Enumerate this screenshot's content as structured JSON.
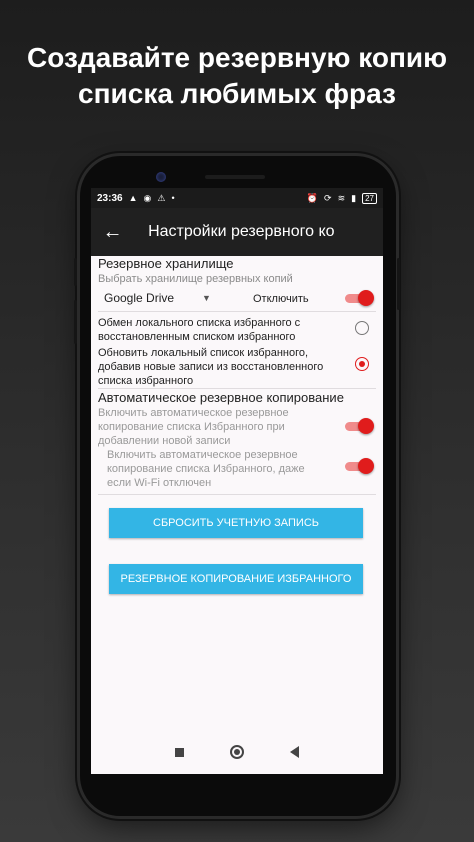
{
  "headline": {
    "line1": "Создавайте резервную копию",
    "line2": "списка любимых фраз"
  },
  "statusbar": {
    "time": "23:36",
    "battery": "27"
  },
  "appbar": {
    "title": "Настройки резервного ко"
  },
  "storage": {
    "title": "Резервное хранилище",
    "subtitle": "Выбрать хранилище резервных копий",
    "selected": "Google Drive",
    "disconnect_label": "Отключить",
    "toggle_on": true
  },
  "sync_options": [
    {
      "text": "Обмен локального списка избранного с восстановленным списком избранного",
      "selected": false
    },
    {
      "text": "Обновить локальный список избранного, добавив новые записи из восстановленного списка избранного",
      "selected": true
    }
  ],
  "auto_backup": {
    "title": "Автоматическое резервное копирование",
    "option1": "Включить автоматическое резервное копирование списка Избранного при добавлении новой записи",
    "option1_on": true,
    "option2": "Включить автоматическое резервное копирование списка Избранного, даже если Wi-Fi отключен",
    "option2_on": true
  },
  "buttons": {
    "reset": "СБРОСИТЬ УЧЕТНУЮ ЗАПИСЬ",
    "backup": "РЕЗЕРВНОЕ КОПИРОВАНИЕ ИЗБРАННОГО"
  },
  "colors": {
    "accent": "#e01c1c",
    "button": "#33b5e5",
    "appbar": "#202020"
  }
}
